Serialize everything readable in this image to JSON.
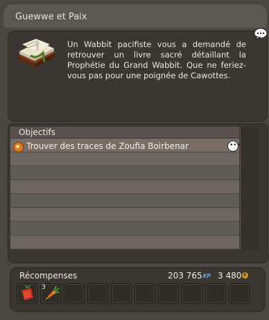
{
  "window": {
    "title": "Guewwe et Paix"
  },
  "description": {
    "text": "Un Wabbit pacifiste vous a demandé de retrouver un livre sacré détaillant la Prophétie du Grand Wabbit. Que ne feriez-vous pas pour une poignée de Cawottes.",
    "icon": "book-icon"
  },
  "objectives": {
    "header": "Objectifs",
    "items": [
      {
        "label": "Trouver des traces de Zoufia Boirbenar",
        "icon": "quest-objective-icon"
      }
    ]
  },
  "rewards": {
    "title": "Récompenses",
    "xp_value": "203 765",
    "xp_label": "XP",
    "kamas_value": "3 480",
    "kamas_symbol": "K",
    "items": [
      {
        "icon": "red-vegetable-icon",
        "quantity": ""
      },
      {
        "icon": "carrot-icon",
        "quantity": "3"
      }
    ]
  },
  "colors": {
    "panel_bg": "#4a4640",
    "box_bg": "#3a3631",
    "objective_icon": "#e07b1a",
    "xp_color": "#6fa8e6",
    "kamas_color": "#d9a21f"
  }
}
